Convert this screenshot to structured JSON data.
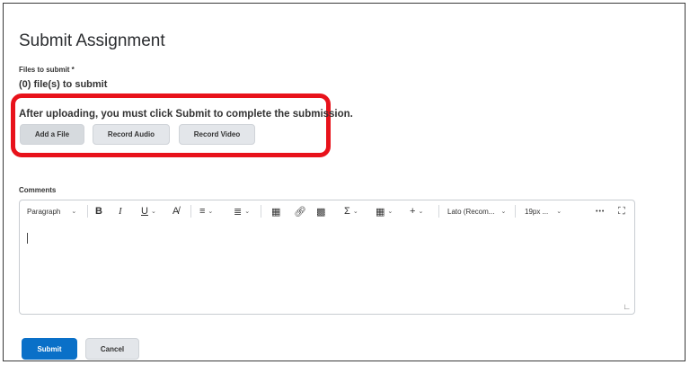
{
  "page": {
    "title": "Submit Assignment"
  },
  "files": {
    "label": "Files to submit *",
    "count_text": "(0) file(s) to submit"
  },
  "upload": {
    "note": "After uploading, you must click Submit to complete the submission.",
    "add_file": "Add a File",
    "record_audio": "Record Audio",
    "record_video": "Record Video",
    "highlight_color": "#e8121b"
  },
  "comments": {
    "label": "Comments",
    "toolbar": {
      "paragraph": "Paragraph",
      "bold": "B",
      "italic": "I",
      "underline": "U",
      "font_family": "Lato (Recom...",
      "font_size": "19px ...",
      "more": "•••"
    }
  },
  "actions": {
    "submit": "Submit",
    "cancel": "Cancel",
    "submit_color": "#0a70c8"
  }
}
